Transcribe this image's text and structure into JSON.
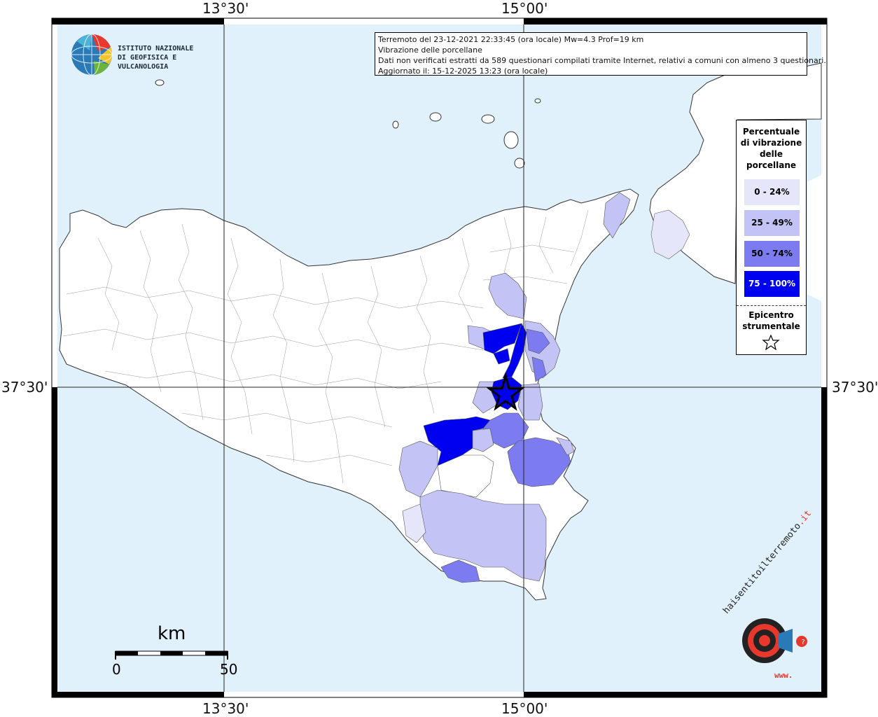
{
  "axes": {
    "top_lon_1": "13°30'",
    "top_lon_2": "15°00'",
    "bottom_lon_1": "13°30'",
    "bottom_lon_2": "15°00'",
    "left_lat": "37°30'",
    "right_lat": "37°30'"
  },
  "logo": {
    "line1": "ISTITUTO NAZIONALE",
    "line2": "DI GEOFISICA E VULCANOLOGIA"
  },
  "info": {
    "line1": "Terremoto del 23-12-2021 22:33:45 (ora locale) Mw=4.3 Prof=19 km",
    "line2": "Vibrazione delle porcellane",
    "line3": "Dati non verificati estratti da 589 questionari compilati tramite Internet, relativi a comuni con almeno 3 questionari.",
    "line4": "Aggiornato il: 15-12-2025 13:23 (ora locale)"
  },
  "legend": {
    "title_lines": [
      "Percentuale",
      "di vibrazione",
      "delle",
      "porcellane"
    ],
    "items": [
      {
        "label": "0 - 24%",
        "color": "#e6e6fa",
        "text_color": "#000000"
      },
      {
        "label": "25 - 49%",
        "color": "#c3c3f5",
        "text_color": "#000000"
      },
      {
        "label": "50 - 74%",
        "color": "#7c7cf0",
        "text_color": "#000000"
      },
      {
        "label": "75 - 100%",
        "color": "#0000f0",
        "text_color": "#ffffff"
      }
    ],
    "epicentre_lines": [
      "Epicentro",
      "strumentale"
    ],
    "epicentre_icon": "star-outline-icon"
  },
  "scale": {
    "unit": "km",
    "start": "0",
    "end": "50"
  },
  "colors": {
    "sea": "#e1f1fb",
    "land": "#ffffff",
    "class_0_24": "#e6e6fa",
    "class_25_49": "#c3c3f5",
    "class_50_74": "#7c7cf0",
    "class_75_100": "#0000f0"
  },
  "watermark": {
    "text_main": "haisentitoilterremoto",
    "text_it": ".it",
    "text_www": "www."
  }
}
